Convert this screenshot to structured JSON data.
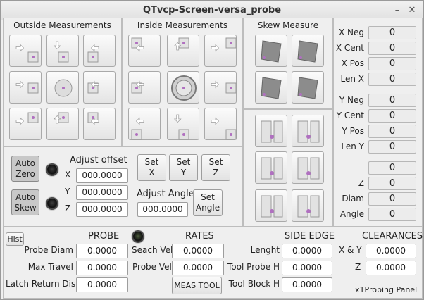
{
  "window": {
    "title": "QTvcp-Screen-versa_probe",
    "minimize": "–",
    "close": "✕"
  },
  "outside": {
    "title": "Outside Measurements"
  },
  "inside": {
    "title": "Inside Measurements"
  },
  "skew": {
    "title": "Skew Measure"
  },
  "readouts": [
    {
      "label": "X Neg",
      "value": "0"
    },
    {
      "label": "X Cent",
      "value": "0"
    },
    {
      "label": "X Pos",
      "value": "0"
    },
    {
      "label": "Len X",
      "value": "0"
    },
    {
      "label": "Y Neg",
      "value": "0"
    },
    {
      "label": "Y Cent",
      "value": "0"
    },
    {
      "label": "Y Pos",
      "value": "0"
    },
    {
      "label": "Len Y",
      "value": "0"
    },
    {
      "label": "",
      "value": "0"
    },
    {
      "label": "Z",
      "value": "0"
    },
    {
      "label": "Diam",
      "value": "0"
    },
    {
      "label": "Angle",
      "value": "0"
    }
  ],
  "adjust": {
    "auto_zero_line1": "Auto",
    "auto_zero_line2": "Zero",
    "auto_skew_line1": "Auto",
    "auto_skew_line2": "Skew",
    "offset_title": "Adjust offset",
    "x_label": "X",
    "y_label": "Y",
    "z_label": "Z",
    "x_value": "000.0000",
    "y_value": "000.0000",
    "z_value": "000.0000",
    "set_x_1": "Set",
    "set_x_2": "X",
    "set_y_1": "Set",
    "set_y_2": "Y",
    "set_z_1": "Set",
    "set_z_2": "Z",
    "angle_title": "Adjust Angle",
    "angle_value": "000.0000",
    "set_angle_1": "Set",
    "set_angle_2": "Angle"
  },
  "bottom": {
    "hist": "Hist",
    "probe_title": "PROBE",
    "rates_title": "RATES",
    "side_title": "SIDE EDGE",
    "clear_title": "CLEARANCES",
    "probe_diam_label": "Probe Diam",
    "probe_diam": "0.0000",
    "max_travel_label": "Max Travel",
    "max_travel": "0.0000",
    "latch_label": "Latch Return Dist",
    "latch": "0.0000",
    "search_vel_label": "Seach Vel",
    "search_vel": "0.0000",
    "probe_vel_label": "Probe Vel",
    "probe_vel": "0.0000",
    "meas_tool": "MEAS TOOL",
    "lenght_label": "Lenght",
    "lenght": "0.0000",
    "tool_probe_h_label": "Tool Probe H",
    "tool_probe_h": "0.0000",
    "tool_block_h_label": "Tool Block H",
    "tool_block_h": "0.0000",
    "xy_label": "X & Y",
    "xy": "0.0000",
    "z_label": "Z",
    "z": "0.0000",
    "footer": "x1Probing  Panel"
  }
}
